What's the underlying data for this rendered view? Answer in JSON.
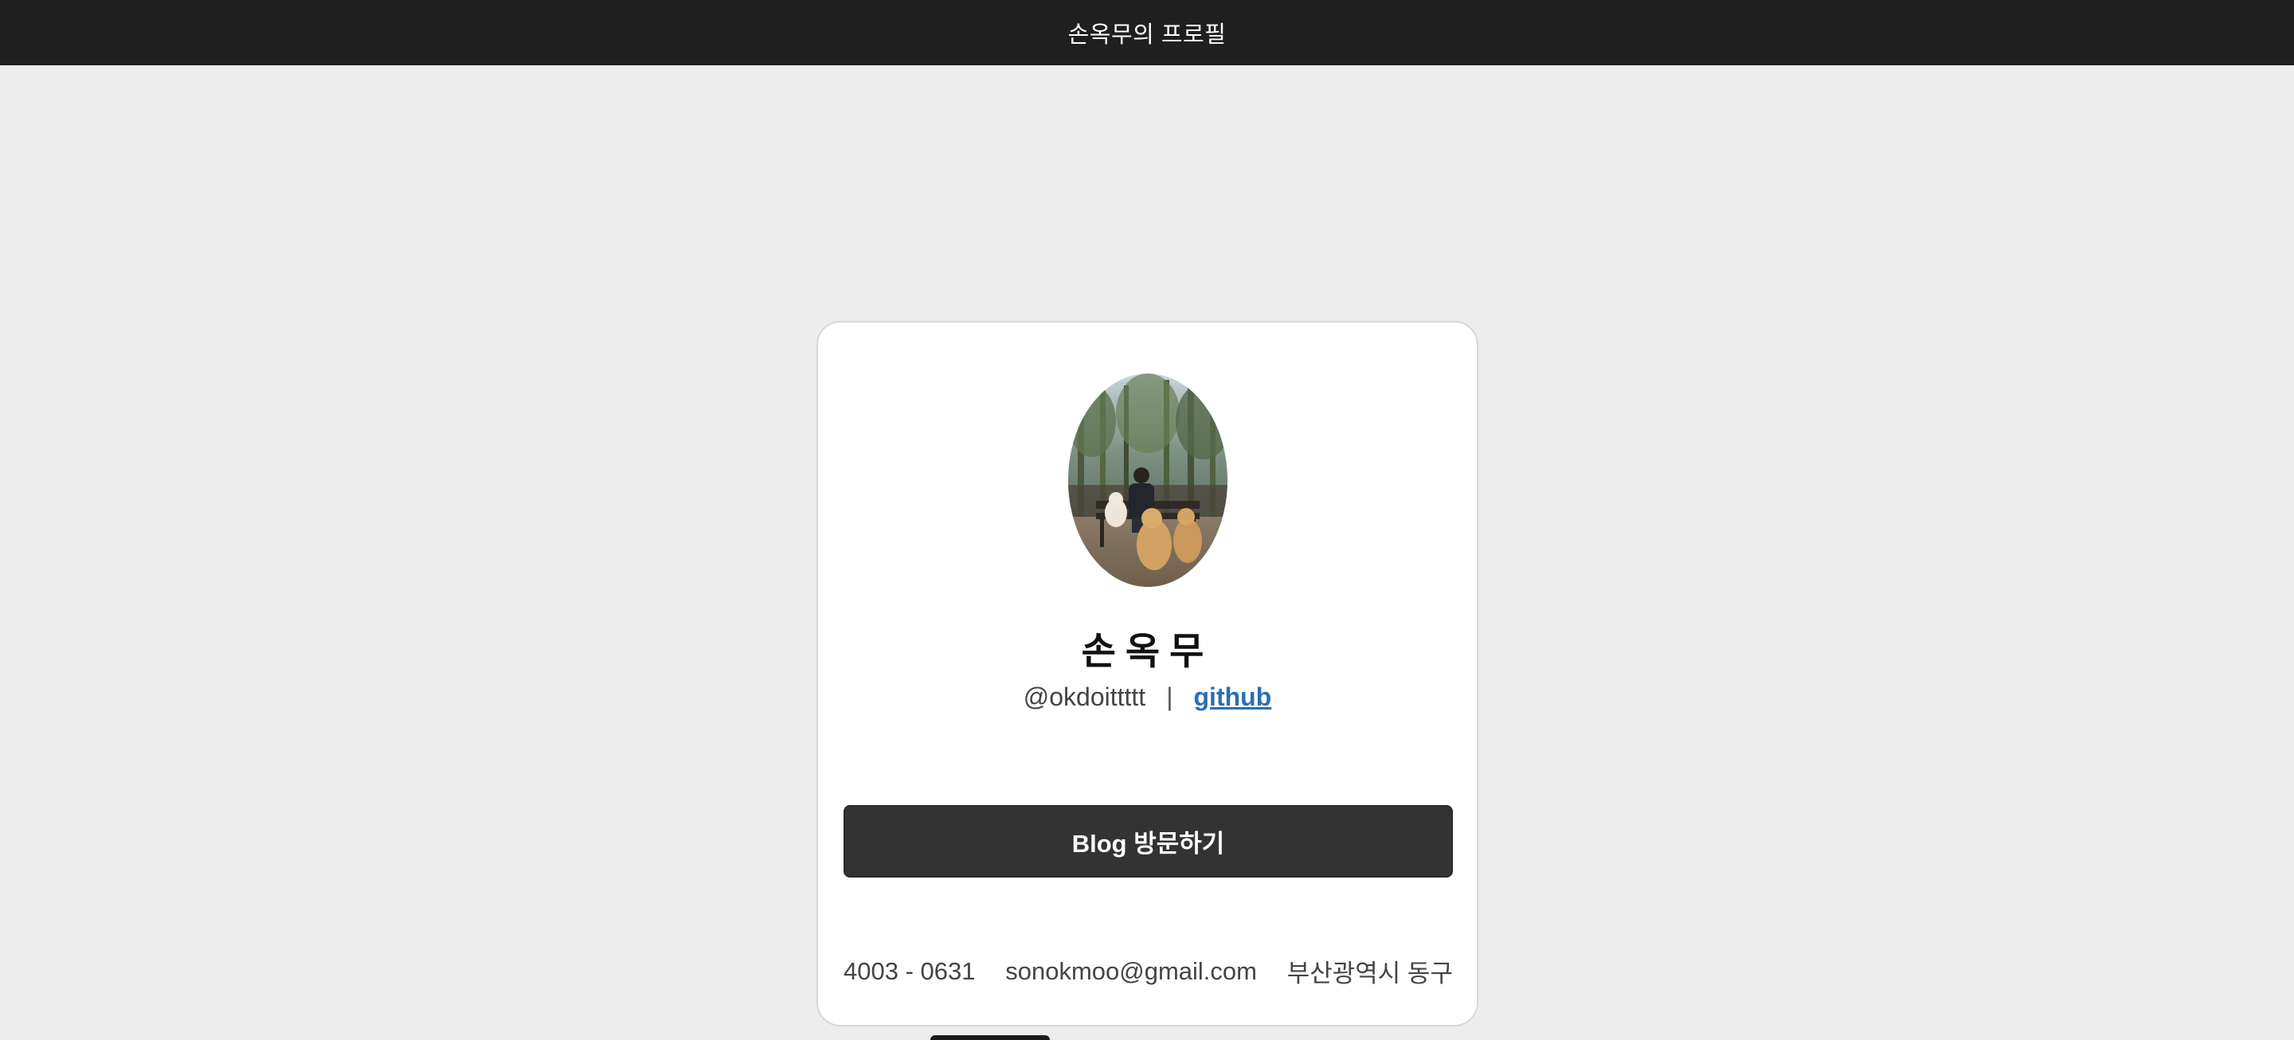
{
  "header": {
    "title": "손옥무의 프로필"
  },
  "profile": {
    "avatar_icon": "profile-photo",
    "name": "손옥무",
    "handle": "@okdoittttt",
    "separator": "|",
    "github_label": "github"
  },
  "blog_button": {
    "label": "Blog 방문하기"
  },
  "contact": {
    "phone": "4003 - 0631",
    "email": "sonokmoo@gmail.com",
    "address": "부산광역시 동구"
  },
  "colors": {
    "topbar": "#1f1f1f",
    "background": "#ededed",
    "card": "#ffffff",
    "button": "#333333",
    "link": "#2a6fb0"
  }
}
